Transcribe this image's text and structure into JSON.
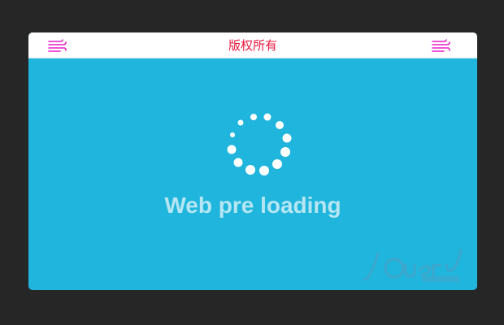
{
  "header": {
    "title": "版权所有",
    "left_icon": "menu-icon",
    "right_icon": "menu-icon",
    "icon_color": "#e61fc8",
    "title_color": "#e8173f"
  },
  "main": {
    "background": "#1fb5dd",
    "spinner_icon": "loading-spinner-icon",
    "loading_text": "Web pre loading"
  },
  "watermark": {
    "logo": "jquery-logo-watermark"
  }
}
